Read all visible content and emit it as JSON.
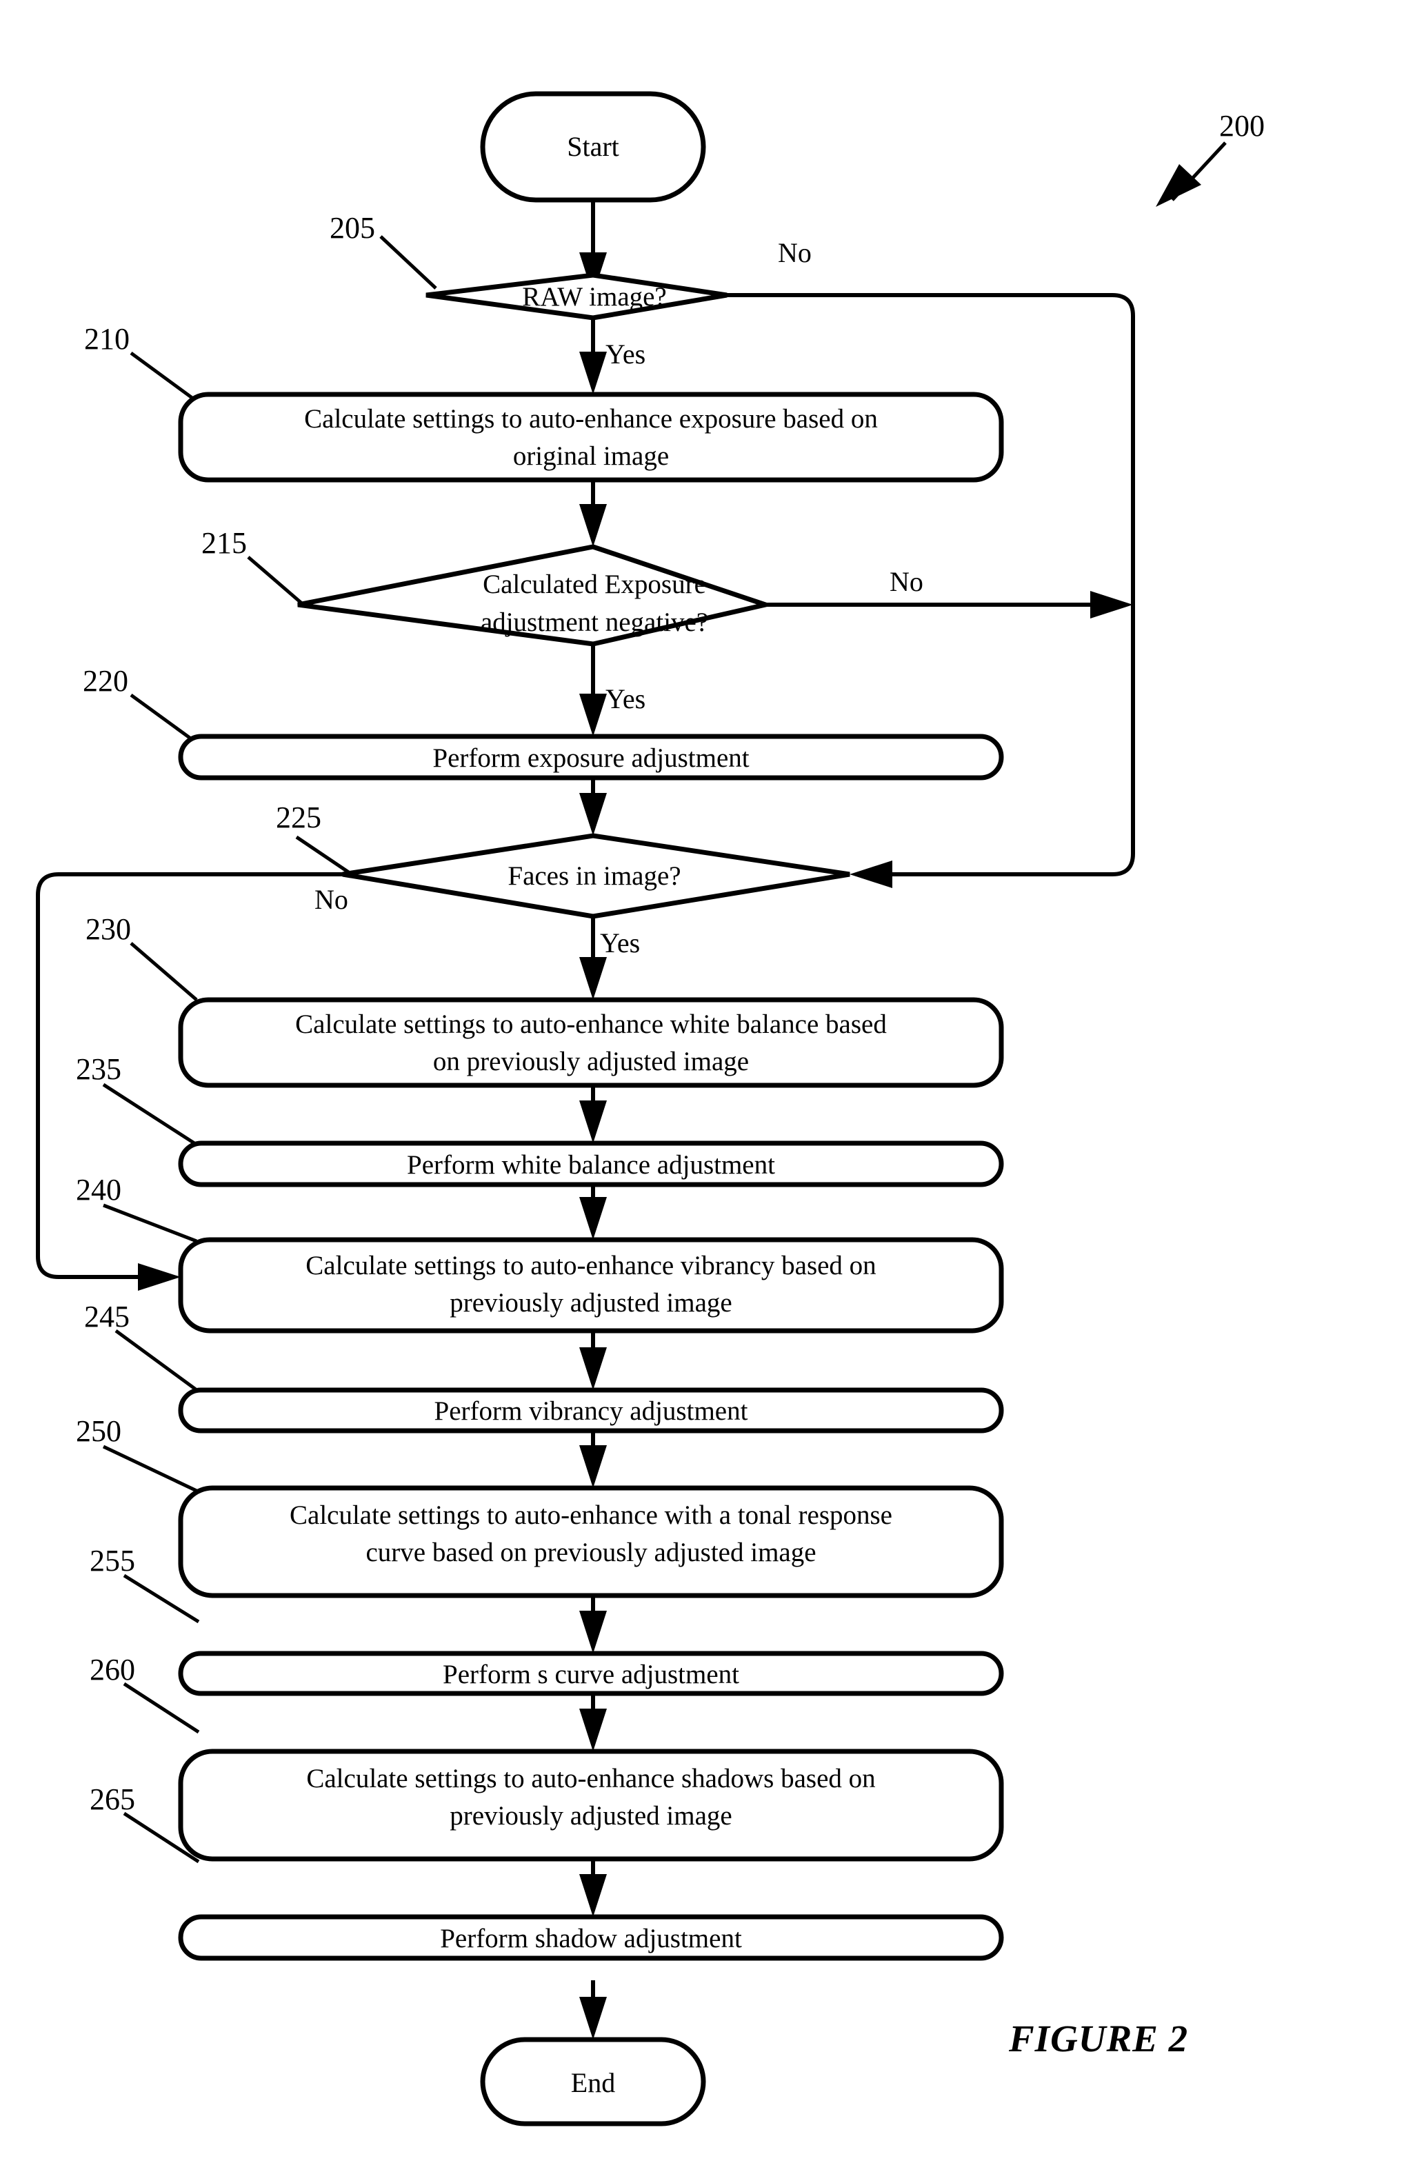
{
  "figure": {
    "caption": "FIGURE 2",
    "diagram_ref": "200"
  },
  "nodes": {
    "start": {
      "label": "Start",
      "type": "terminal"
    },
    "end": {
      "label": "End",
      "type": "terminal"
    },
    "d205": {
      "ref": "205",
      "label": "RAW image?",
      "type": "decision",
      "yes": "Yes",
      "no": "No"
    },
    "p210": {
      "ref": "210",
      "line1": "Calculate settings to auto-enhance exposure based on",
      "line2": "original image",
      "type": "process"
    },
    "d215": {
      "ref": "215",
      "line1": "Calculated Exposure",
      "line2": "adjustment negative?",
      "type": "decision",
      "yes": "Yes",
      "no": "No"
    },
    "p220": {
      "ref": "220",
      "line1": "Perform exposure adjustment",
      "type": "process"
    },
    "d225": {
      "ref": "225",
      "label": "Faces in image?",
      "type": "decision",
      "yes": "Yes",
      "no": "No"
    },
    "p230": {
      "ref": "230",
      "line1": "Calculate settings to auto-enhance white balance based",
      "line2": "on previously adjusted image",
      "type": "process"
    },
    "p235": {
      "ref": "235",
      "line1": "Perform white balance adjustment",
      "type": "process"
    },
    "p240": {
      "ref": "240",
      "line1": "Calculate settings to auto-enhance vibrancy based on",
      "line2": "previously adjusted image",
      "type": "process"
    },
    "p245": {
      "ref": "245",
      "line1": "Perform vibrancy adjustment",
      "type": "process"
    },
    "p250": {
      "ref": "250",
      "line1": "Calculate settings to auto-enhance with a tonal response",
      "line2": "curve  based on previously adjusted image",
      "type": "process"
    },
    "p255": {
      "ref": "255",
      "line1": "Perform s curve adjustment",
      "type": "process"
    },
    "p260": {
      "ref": "260",
      "line1": "Calculate settings to auto-enhance shadows based on",
      "line2": "previously adjusted image",
      "type": "process"
    },
    "p265": {
      "ref": "265",
      "line1": "Perform shadow adjustment",
      "type": "process"
    }
  },
  "colors": {
    "ink": "#000000",
    "paper": "#ffffff"
  }
}
